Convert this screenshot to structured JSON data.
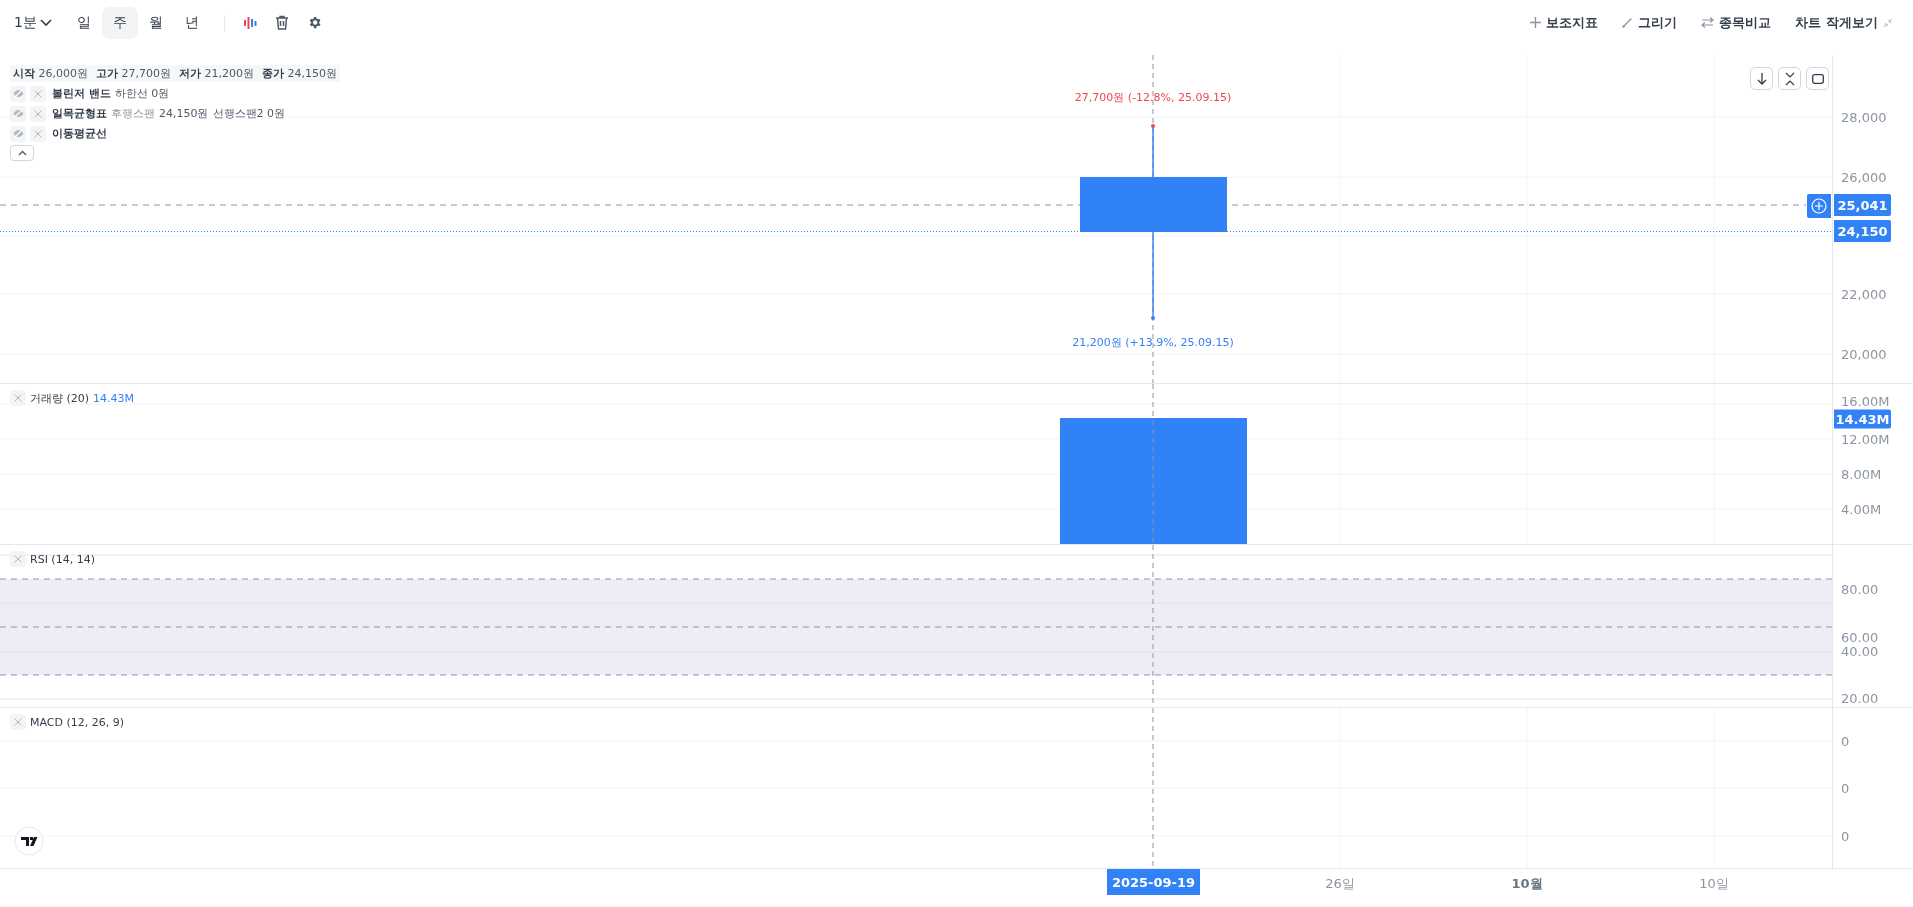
{
  "toolbar": {
    "interval": "1분",
    "periods": [
      {
        "label": "일",
        "selected": false
      },
      {
        "label": "주",
        "selected": true
      },
      {
        "label": "월",
        "selected": false
      },
      {
        "label": "년",
        "selected": false
      }
    ],
    "actions": [
      {
        "label": "보조지표",
        "kind": "add"
      },
      {
        "label": "그리기",
        "kind": "draw"
      },
      {
        "label": "종목비교",
        "kind": "compare"
      },
      {
        "label": "차트 작게보기",
        "kind": "shrink"
      }
    ]
  },
  "price_pane": {
    "ohlc": [
      {
        "label": "시작",
        "value": "26,000원"
      },
      {
        "label": "고가",
        "value": "27,700원"
      },
      {
        "label": "저가",
        "value": "21,200원"
      },
      {
        "label": "종가",
        "value": "24,150원"
      }
    ],
    "indicators": [
      {
        "name": "볼린저 밴드",
        "details": [
          {
            "text": "하한선 0원",
            "muted": false
          }
        ]
      },
      {
        "name": "일목균형표",
        "details": [
          {
            "text": "후행스팬",
            "muted": true
          },
          {
            "text": "24,150원",
            "muted": false
          },
          {
            "text": "선행스팬2 0원",
            "muted": false
          }
        ]
      },
      {
        "name": "이동평균선"
      }
    ],
    "high_marker": "27,700원 (-12.8%, 25.09.15)",
    "low_marker": "21,200원 (+13.9%, 25.09.15)",
    "axis_ticks": [
      "28,000",
      "26,000",
      "22,000",
      "20,000"
    ],
    "crosshair_price": "25,041",
    "last_price": "24,150"
  },
  "volume_pane": {
    "title": "거래량 (20)",
    "value": "14.43M",
    "last_value": "14.43M",
    "axis_ticks": [
      "16.00M",
      "12.00M",
      "8.00M",
      "4.00M"
    ]
  },
  "rsi_pane": {
    "title": "RSI (14, 14)",
    "axis_ticks": [
      "80.00",
      "60.00",
      "40.00",
      "20.00"
    ]
  },
  "macd_pane": {
    "title": "MACD (12, 26, 9)",
    "axis_ticks": [
      "0",
      "0",
      "0"
    ]
  },
  "time_axis": {
    "crosshair_date": "2025-09-19",
    "ticks": [
      {
        "label": "26일",
        "major": false
      },
      {
        "label": "10월",
        "major": true
      },
      {
        "label": "10일",
        "major": false
      }
    ]
  }
}
